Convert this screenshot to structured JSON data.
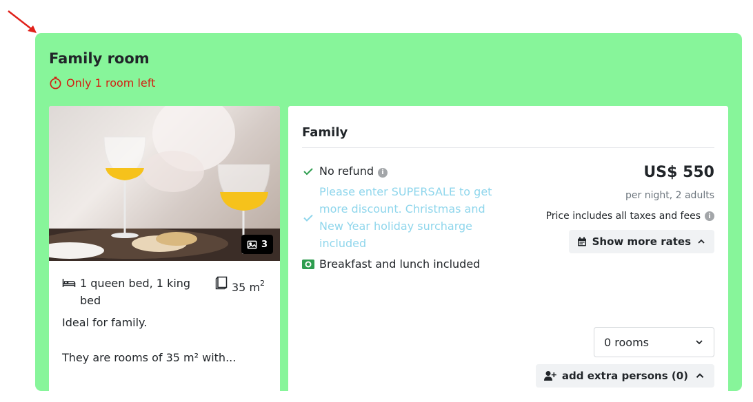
{
  "room": {
    "title": "Family room",
    "availability": "Only 1 room left",
    "photo_count": "3",
    "bed_info": "1 queen bed, 1 king bed",
    "size_value": "35 m",
    "size_sup": "2",
    "description_line1": "Ideal for family.",
    "description_line2": "They are rooms of 35 m² with..."
  },
  "rate": {
    "name": "Family",
    "refund_policy": "No refund",
    "promo_text": "Please enter SUPERSALE to get more discount. Christmas and New Year holiday surcharge included",
    "meal_plan": "Breakfast and lunch included",
    "price": "US$ 550",
    "price_note": "per night, 2 adults",
    "taxes_note": "Price includes all taxes and fees",
    "show_more_label": "Show more rates",
    "rooms_selected": "0 rooms",
    "extra_persons_label": "add extra persons (0)"
  },
  "colors": {
    "card_background": "#87f59a",
    "availability": "#d31f12",
    "promo": "#8fd6ec",
    "arrow": "#e0211a"
  },
  "icons": {
    "availability": "stopwatch-icon",
    "photos": "image-icon",
    "bed": "bed-icon",
    "size": "room-size-icon",
    "refund": "check-icon",
    "promo": "check-icon",
    "meal": "utensils-icon",
    "info": "info-icon",
    "rates": "calendar-icon",
    "chevron": "chevron-icon",
    "extra": "user-plus-icon"
  }
}
